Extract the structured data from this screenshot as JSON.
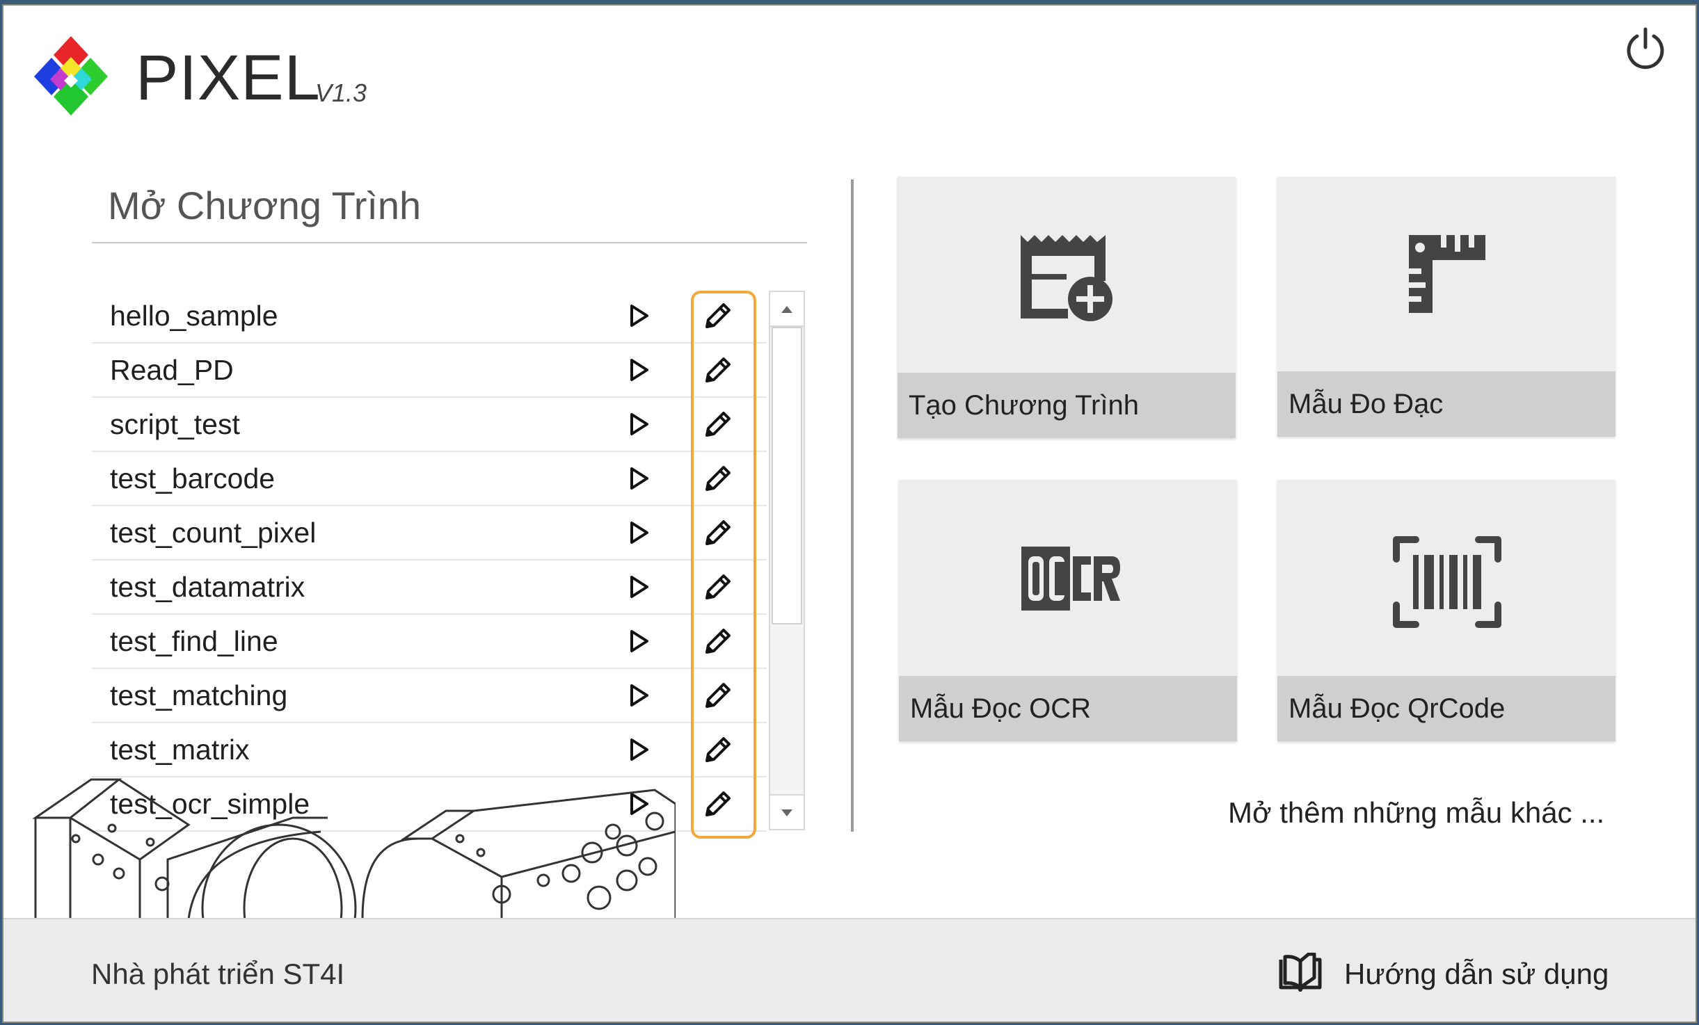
{
  "header": {
    "title": "PIXEL",
    "version": "V1.3"
  },
  "open_program": {
    "title": "Mở Chương Trình",
    "programs": [
      "hello_sample",
      "Read_PD",
      "script_test",
      "test_barcode",
      "test_count_pixel",
      "test_datamatrix",
      "test_find_line",
      "test_matching",
      "test_matrix",
      "test_ocr_simple"
    ]
  },
  "tiles": {
    "create": "Tạo Chương Trình",
    "measure": "Mẫu Đo Đạc",
    "ocr": "Mẫu Đọc OCR",
    "qrcode": "Mẫu Đọc QrCode",
    "ocr_icon_text": "OCR"
  },
  "more_templates": "Mở thêm những mẫu khác ...",
  "footer": {
    "developer": "Nhà phát triển ST4I",
    "guide": "Hướng dẫn sử dụng"
  },
  "colors": {
    "accent_highlight": "#f2a83b",
    "tile_bg": "#ededed",
    "tile_label_bg": "#cfcfcf"
  }
}
